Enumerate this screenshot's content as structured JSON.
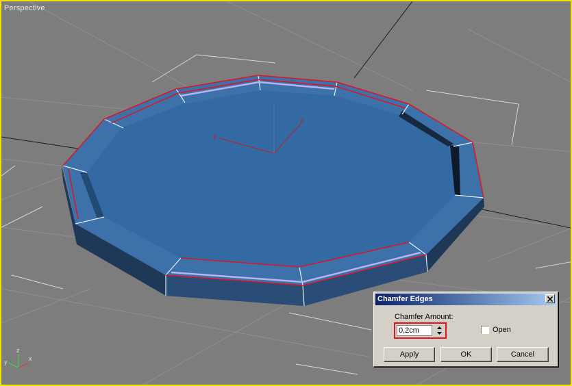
{
  "viewport": {
    "label": "Perspective",
    "border_color": "#f2e400",
    "gizmo_labels": {
      "x": "x",
      "y": "y"
    },
    "corner_axes": {
      "z": "z",
      "y": "y",
      "x": "x"
    }
  },
  "dialog": {
    "title": "Chamfer Edges",
    "chamfer_amount_label": "Chamfer Amount:",
    "chamfer_amount_value": "0,2cm",
    "open_label": "Open",
    "open_checked": false,
    "buttons": {
      "apply": "Apply",
      "ok": "OK",
      "cancel": "Cancel"
    }
  },
  "colors": {
    "object_top": "#3a6ea5",
    "object_inner": "#2f5f94",
    "object_side_dark": "#1d3553",
    "highlight_edge": "#e0141e"
  }
}
